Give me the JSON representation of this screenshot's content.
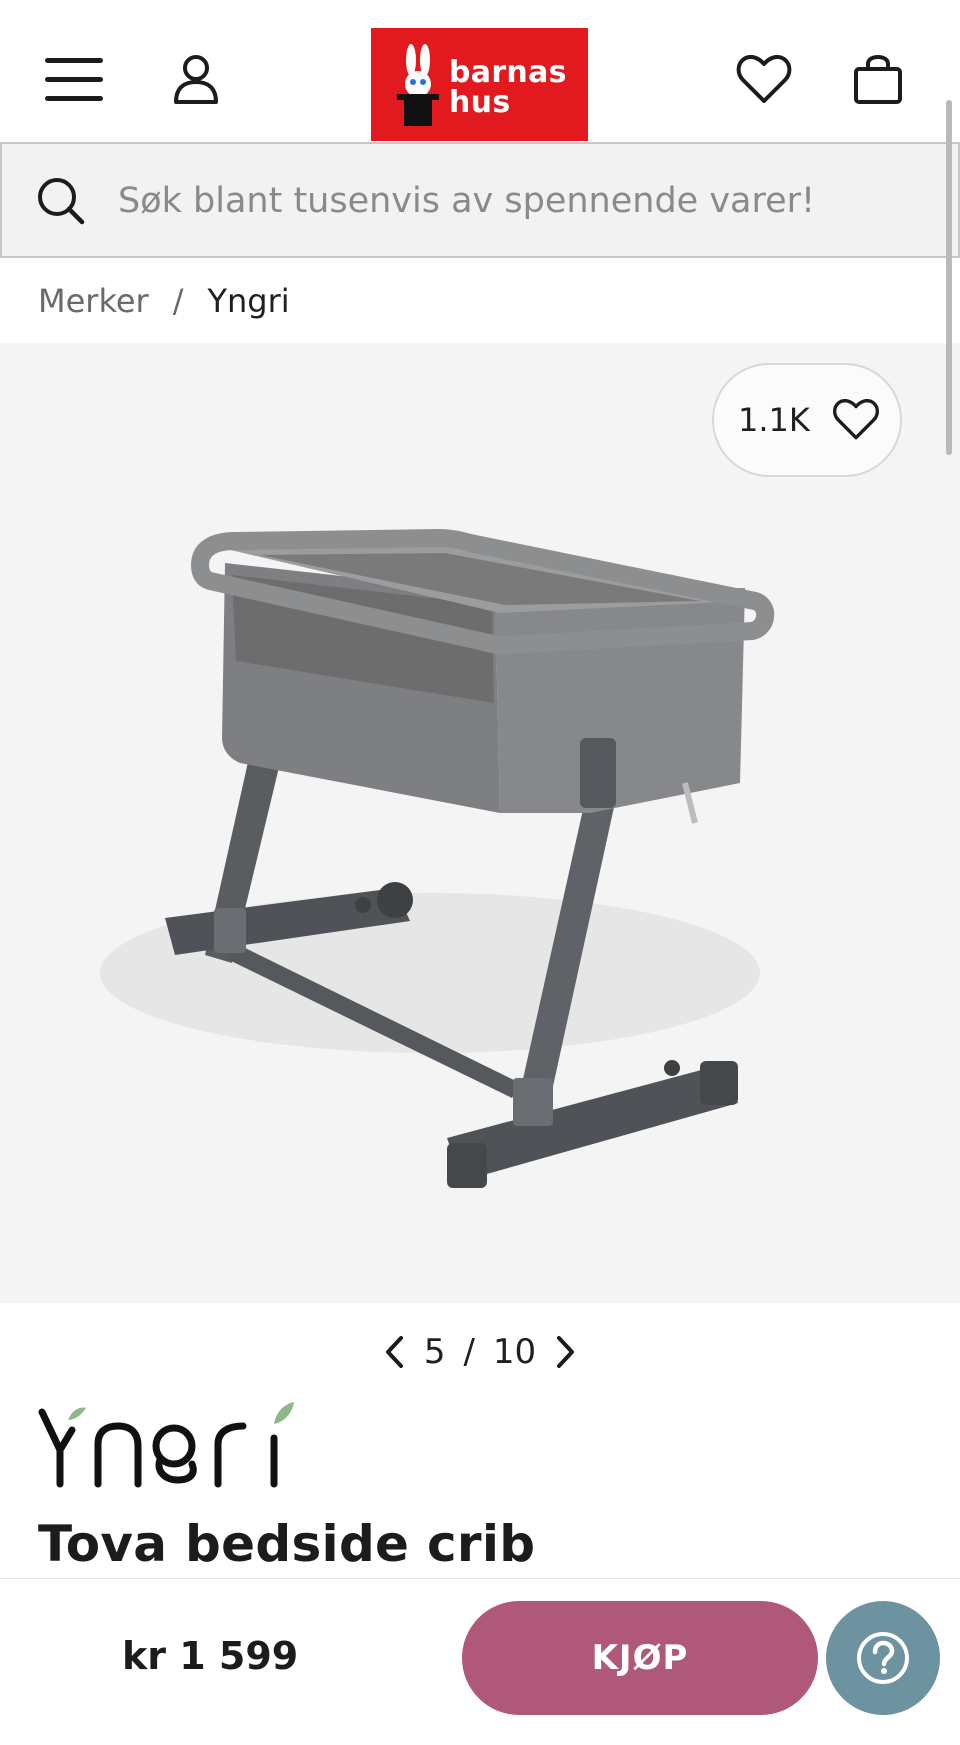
{
  "header": {
    "logo_line1": "barnas",
    "logo_line2": "hus",
    "brand_color": "#e21a1f",
    "icons": [
      "menu-icon",
      "account-icon",
      "heart-icon",
      "shopping-bag-icon"
    ]
  },
  "search": {
    "placeholder": "Søk blant tusenvis av spennende varer!",
    "value": ""
  },
  "breadcrumb": {
    "items": [
      "Merker",
      "Yngri"
    ],
    "separator": "/"
  },
  "gallery": {
    "like_count": "1.1K",
    "current_index": "5",
    "separator": "/",
    "total": "10"
  },
  "product": {
    "brand": "Yngri",
    "title": "Tova bedside crib",
    "price": "kr 1 599"
  },
  "actions": {
    "buy_label": "KJØP",
    "buy_color": "#b0587a",
    "help_color": "#6d93a0"
  }
}
